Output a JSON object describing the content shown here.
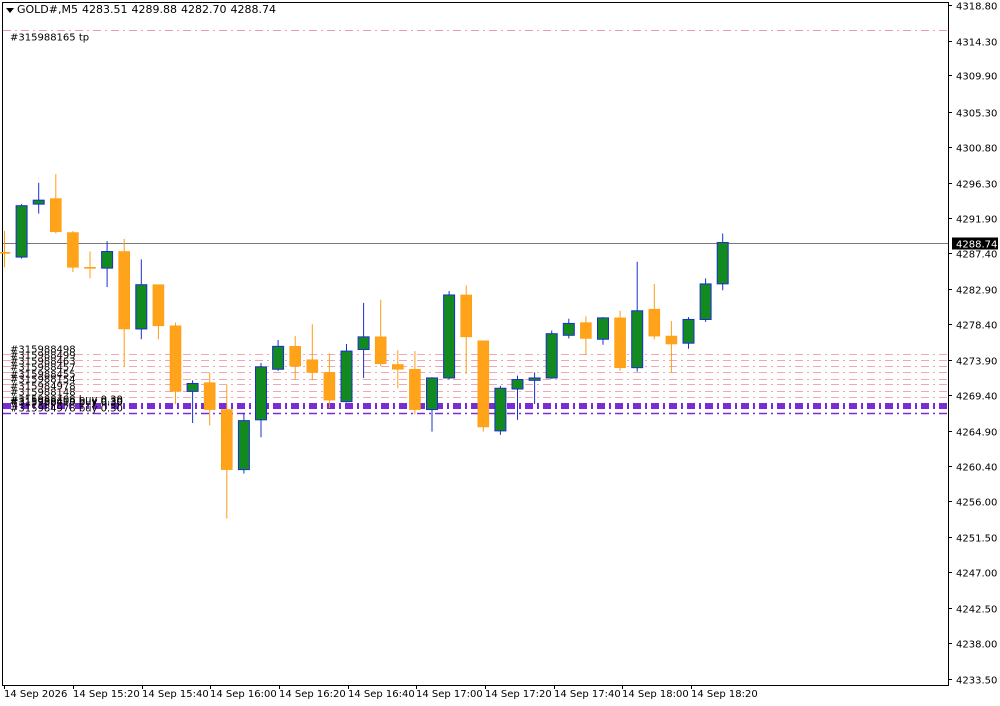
{
  "header": {
    "symbol": "GOLD#,M5",
    "open": "4283.51",
    "high": "4289.88",
    "low": "4282.70",
    "close": "4288.74"
  },
  "colors": {
    "bull_body": "#138a1f",
    "bull_wick": "#1b2fd0",
    "bear_body": "#ffa31a",
    "bear_wick": "#ff9d14",
    "border": "#000000",
    "order_line": "#f2a7b0",
    "tp_line": "#e8a0a8",
    "buy_line": "#7a2bd6",
    "price_line": "#7a7a7a",
    "current_price_bg": "#000000",
    "current_price_fg": "#ffffff"
  },
  "chart_data": {
    "type": "candlestick",
    "title": "GOLD#,M5",
    "ylim": [
      4233.5,
      4318.8
    ],
    "y_ticks": [
      "4318.80",
      "4314.30",
      "4309.90",
      "4305.30",
      "4300.80",
      "4296.30",
      "4291.90",
      "4287.40",
      "4282.90",
      "4278.40",
      "4273.90",
      "4269.40",
      "4264.90",
      "4260.40",
      "4256.00",
      "4251.50",
      "4247.00",
      "4242.50",
      "4238.00",
      "4233.50"
    ],
    "x_ticks": [
      "14 Sep 2026",
      "14 Sep 15:20",
      "14 Sep 15:40",
      "14 Sep 16:00",
      "14 Sep 16:20",
      "14 Sep 16:40",
      "14 Sep 17:00",
      "14 Sep 17:20",
      "14 Sep 17:40",
      "14 Sep 18:00",
      "14 Sep 18:20"
    ],
    "current_price": "4288.74",
    "candles": [
      {
        "o": 4287.5,
        "h": 4290.2,
        "l": 4285.6,
        "c": 4287.4
      },
      {
        "o": 4286.9,
        "h": 4293.6,
        "l": 4286.7,
        "c": 4293.4
      },
      {
        "o": 4293.6,
        "h": 4296.3,
        "l": 4292.4,
        "c": 4294.1
      },
      {
        "o": 4294.3,
        "h": 4297.4,
        "l": 4289.9,
        "c": 4290.1
      },
      {
        "o": 4290.0,
        "h": 4290.2,
        "l": 4285.0,
        "c": 4285.6
      },
      {
        "o": 4285.6,
        "h": 4287.6,
        "l": 4284.2,
        "c": 4285.5
      },
      {
        "o": 4285.5,
        "h": 4288.9,
        "l": 4283.1,
        "c": 4287.6
      },
      {
        "o": 4287.6,
        "h": 4289.2,
        "l": 4273.0,
        "c": 4277.8
      },
      {
        "o": 4277.8,
        "h": 4286.6,
        "l": 4276.5,
        "c": 4283.4
      },
      {
        "o": 4283.4,
        "h": 4283.4,
        "l": 4276.5,
        "c": 4278.2
      },
      {
        "o": 4278.2,
        "h": 4278.6,
        "l": 4268.3,
        "c": 4269.9
      },
      {
        "o": 4269.9,
        "h": 4271.3,
        "l": 4265.9,
        "c": 4270.9
      },
      {
        "o": 4271.0,
        "h": 4272.3,
        "l": 4265.6,
        "c": 4267.6
      },
      {
        "o": 4267.6,
        "h": 4270.7,
        "l": 4253.8,
        "c": 4260.0
      },
      {
        "o": 4260.0,
        "h": 4267.2,
        "l": 4259.5,
        "c": 4266.2
      },
      {
        "o": 4266.3,
        "h": 4273.5,
        "l": 4264.1,
        "c": 4273.0
      },
      {
        "o": 4272.7,
        "h": 4276.4,
        "l": 4272.5,
        "c": 4275.6
      },
      {
        "o": 4275.6,
        "h": 4276.9,
        "l": 4271.4,
        "c": 4273.1
      },
      {
        "o": 4273.9,
        "h": 4278.4,
        "l": 4271.3,
        "c": 4272.3
      },
      {
        "o": 4272.3,
        "h": 4274.7,
        "l": 4267.8,
        "c": 4268.8
      },
      {
        "o": 4268.6,
        "h": 4275.9,
        "l": 4268.5,
        "c": 4275.0
      },
      {
        "o": 4275.2,
        "h": 4281.1,
        "l": 4271.6,
        "c": 4276.8
      },
      {
        "o": 4276.8,
        "h": 4281.5,
        "l": 4273.1,
        "c": 4273.4
      },
      {
        "o": 4273.3,
        "h": 4275.1,
        "l": 4270.3,
        "c": 4272.7
      },
      {
        "o": 4272.7,
        "h": 4275.0,
        "l": 4267.0,
        "c": 4267.6
      },
      {
        "o": 4267.6,
        "h": 4271.7,
        "l": 4264.8,
        "c": 4271.6
      },
      {
        "o": 4271.6,
        "h": 4282.6,
        "l": 4271.4,
        "c": 4282.1
      },
      {
        "o": 4282.1,
        "h": 4283.3,
        "l": 4272.1,
        "c": 4276.8
      },
      {
        "o": 4276.3,
        "h": 4276.3,
        "l": 4264.8,
        "c": 4265.4
      },
      {
        "o": 4264.9,
        "h": 4270.6,
        "l": 4264.4,
        "c": 4270.3
      },
      {
        "o": 4270.2,
        "h": 4271.9,
        "l": 4266.3,
        "c": 4271.4
      },
      {
        "o": 4271.3,
        "h": 4272.3,
        "l": 4268.3,
        "c": 4271.6
      },
      {
        "o": 4271.6,
        "h": 4277.6,
        "l": 4271.5,
        "c": 4277.2
      },
      {
        "o": 4277.0,
        "h": 4279.1,
        "l": 4276.6,
        "c": 4278.5
      },
      {
        "o": 4278.6,
        "h": 4279.4,
        "l": 4274.5,
        "c": 4276.6
      },
      {
        "o": 4276.5,
        "h": 4279.3,
        "l": 4275.8,
        "c": 4279.2
      },
      {
        "o": 4279.2,
        "h": 4280.1,
        "l": 4272.5,
        "c": 4272.9
      },
      {
        "o": 4272.9,
        "h": 4286.3,
        "l": 4272.4,
        "c": 4280.1
      },
      {
        "o": 4280.3,
        "h": 4283.5,
        "l": 4276.5,
        "c": 4276.9
      },
      {
        "o": 4276.9,
        "h": 4278.8,
        "l": 4272.3,
        "c": 4275.9
      },
      {
        "o": 4276.0,
        "h": 4279.3,
        "l": 4275.3,
        "c": 4279.0
      },
      {
        "o": 4279.0,
        "h": 4284.2,
        "l": 4278.7,
        "c": 4283.5
      },
      {
        "o": 4283.51,
        "h": 4289.88,
        "l": 4282.7,
        "c": 4288.74
      }
    ],
    "levels": [
      {
        "price": 4315.6,
        "label": "#315988165 tp",
        "kind": "tp"
      },
      {
        "price": 4274.6,
        "label": "#315988498",
        "kind": "order"
      },
      {
        "price": 4273.9,
        "label": "#315988499",
        "kind": "order"
      },
      {
        "price": 4273.1,
        "label": "#315988463",
        "kind": "order"
      },
      {
        "price": 4272.3,
        "label": "#315988457",
        "kind": "order"
      },
      {
        "price": 4271.5,
        "label": "#315988455",
        "kind": "order"
      },
      {
        "price": 4270.8,
        "label": "#315988154",
        "kind": "order"
      },
      {
        "price": 4270.0,
        "label": "#315984978",
        "kind": "order"
      },
      {
        "price": 4269.2,
        "label": "#315988148",
        "kind": "order"
      },
      {
        "price": 4268.3,
        "label": "#315988408 buy 0.30",
        "kind": "buy"
      },
      {
        "price": 4268.1,
        "label": "#315988409 buy 0.30",
        "kind": "buy"
      },
      {
        "price": 4267.9,
        "label": "#315988410 buy 0.30",
        "kind": "buy"
      },
      {
        "price": 4267.2,
        "label": "#315984978 buy 0.30",
        "kind": "buy"
      }
    ]
  }
}
